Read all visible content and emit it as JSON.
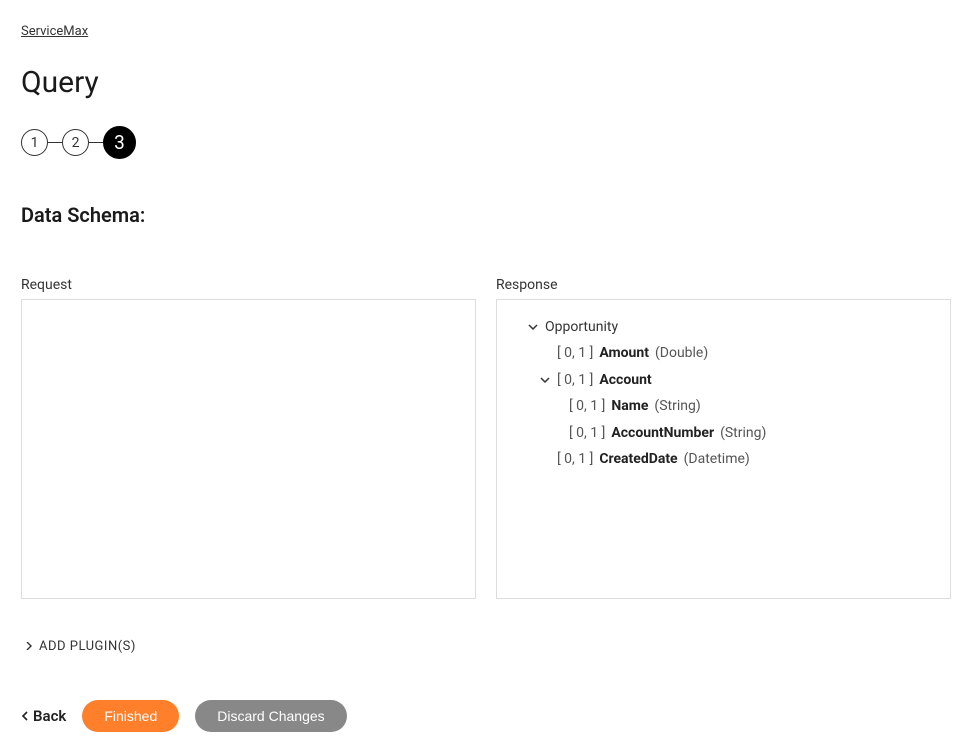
{
  "breadcrumb": "ServiceMax",
  "pageTitle": "Query",
  "steps": [
    "1",
    "2",
    "3"
  ],
  "currentStep": 3,
  "sectionTitle": "Data Schema:",
  "requestLabel": "Request",
  "responseLabel": "Response",
  "tree": {
    "root": "Opportunity",
    "amount": {
      "card": "[ 0, 1 ]",
      "name": "Amount",
      "type": "(Double)"
    },
    "account": {
      "card": "[ 0, 1 ]",
      "name": "Account"
    },
    "accName": {
      "card": "[ 0, 1 ]",
      "name": "Name",
      "type": "(String)"
    },
    "accNum": {
      "card": "[ 0, 1 ]",
      "name": "AccountNumber",
      "type": "(String)"
    },
    "created": {
      "card": "[ 0, 1 ]",
      "name": "CreatedDate",
      "type": "(Datetime)"
    }
  },
  "addPlugins": "ADD PLUGIN(S)",
  "back": "Back",
  "finished": "Finished",
  "discard": "Discard Changes"
}
